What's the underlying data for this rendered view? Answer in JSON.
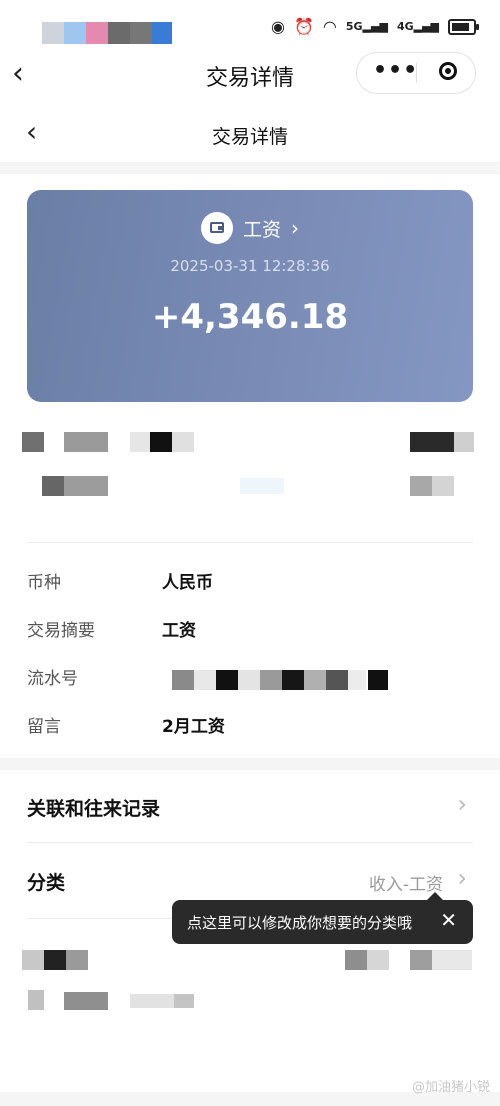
{
  "app_bar": {
    "title": "交易详情"
  },
  "page_header": {
    "title": "交易详情"
  },
  "transaction_card": {
    "category": "工资",
    "datetime": "2025-03-31 12:28:36",
    "amount": "+4,346.18"
  },
  "details": [
    {
      "label": "币种",
      "value": "人民币"
    },
    {
      "label": "交易摘要",
      "value": "工资"
    },
    {
      "label": "流水号",
      "value": ""
    },
    {
      "label": "留言",
      "value": "2月工资"
    }
  ],
  "links": {
    "related_records": {
      "label": "关联和往来记录"
    },
    "category": {
      "label": "分类",
      "value": "收入-工资"
    }
  },
  "tooltip": {
    "text": "点这里可以修改成你想要的分类哦"
  },
  "watermark": {
    "text": "@加油猪小锐"
  },
  "colors": {
    "card_gradient_start": "#6a7ea6",
    "card_gradient_end": "#8497c2",
    "tooltip_bg": "#2a2a2a"
  }
}
